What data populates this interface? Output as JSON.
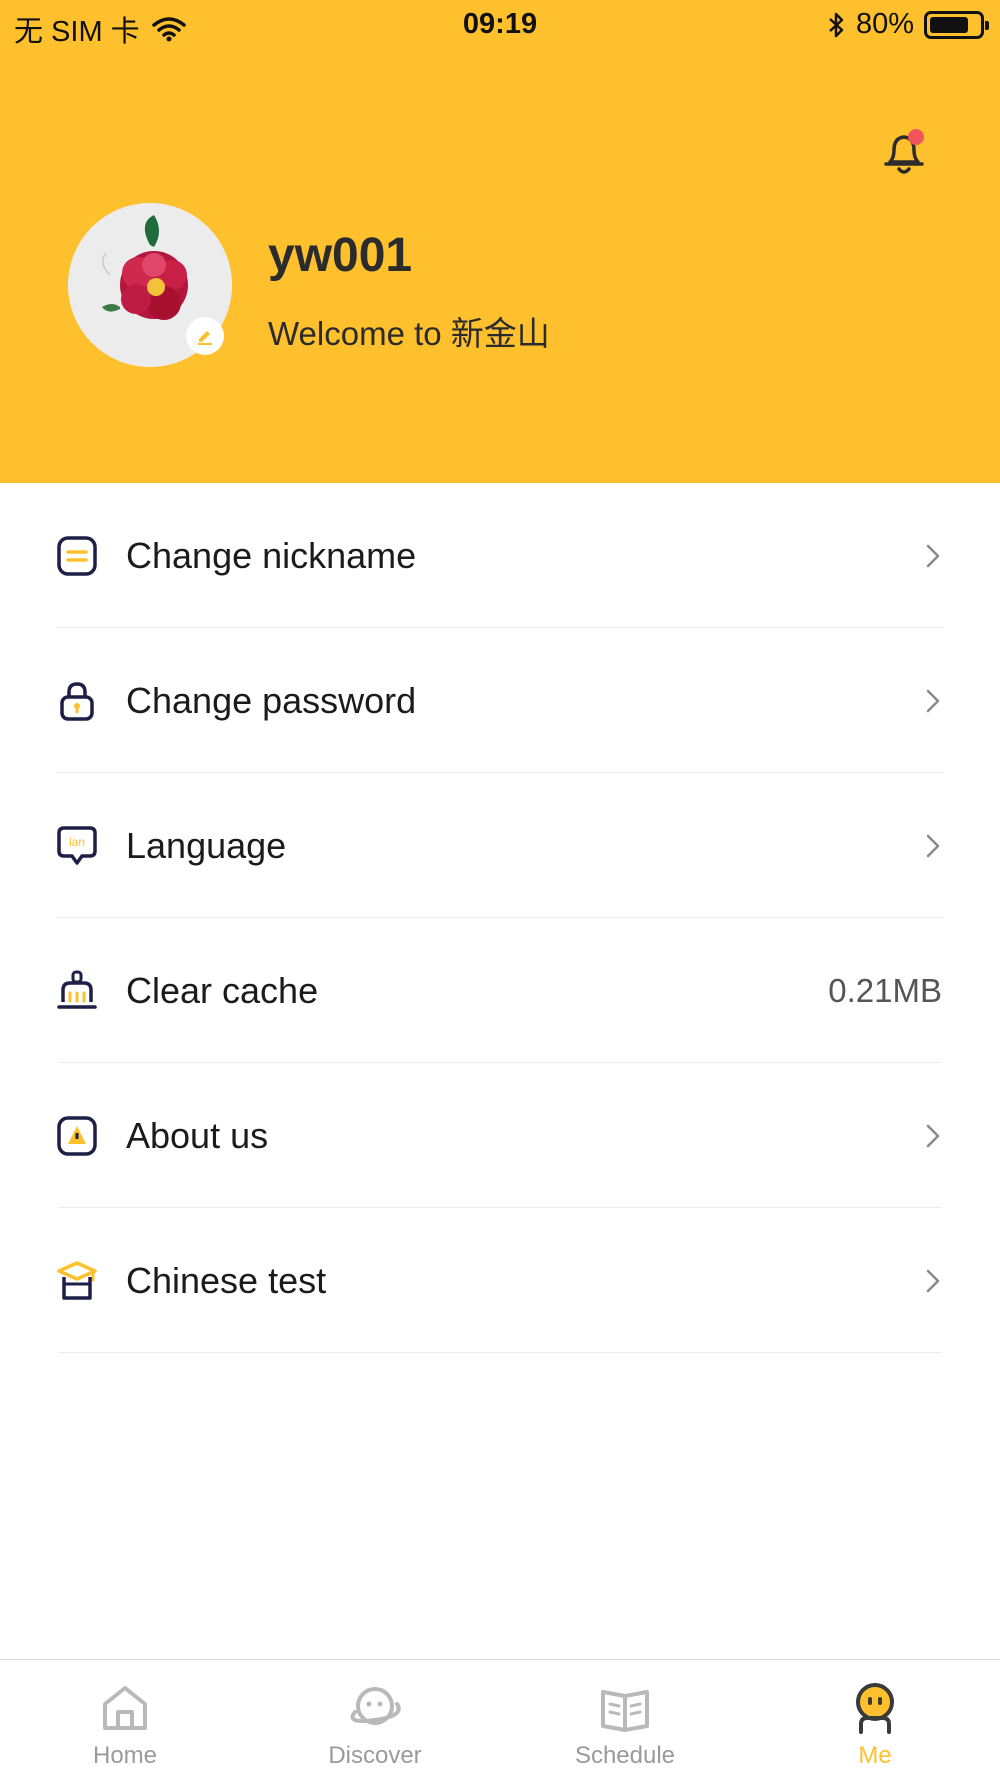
{
  "status_bar": {
    "carrier": "无 SIM 卡",
    "time": "09:19",
    "battery": "80%",
    "battery_level": 0.8
  },
  "profile": {
    "username": "yw001",
    "welcome": "Welcome to 新金山"
  },
  "menu": {
    "items": [
      {
        "label": "Change nickname",
        "icon": "nickname-card-icon"
      },
      {
        "label": "Change password",
        "icon": "lock-icon"
      },
      {
        "label": "Language",
        "icon": "language-bubble-icon"
      },
      {
        "label": "Clear cache",
        "icon": "broom-icon",
        "value": "0.21MB"
      },
      {
        "label": "About us",
        "icon": "info-square-icon"
      },
      {
        "label": "Chinese test",
        "icon": "graduation-cap-icon"
      }
    ]
  },
  "tabbar": {
    "tabs": [
      {
        "label": "Home",
        "icon": "home-icon",
        "active": false
      },
      {
        "label": "Discover",
        "icon": "planet-icon",
        "active": false
      },
      {
        "label": "Schedule",
        "icon": "book-icon",
        "active": false
      },
      {
        "label": "Me",
        "icon": "person-icon",
        "active": true
      }
    ]
  },
  "colors": {
    "accent": "#fec02c",
    "notification_dot": "#f2545b",
    "icon_stroke": "#1d1f46"
  }
}
